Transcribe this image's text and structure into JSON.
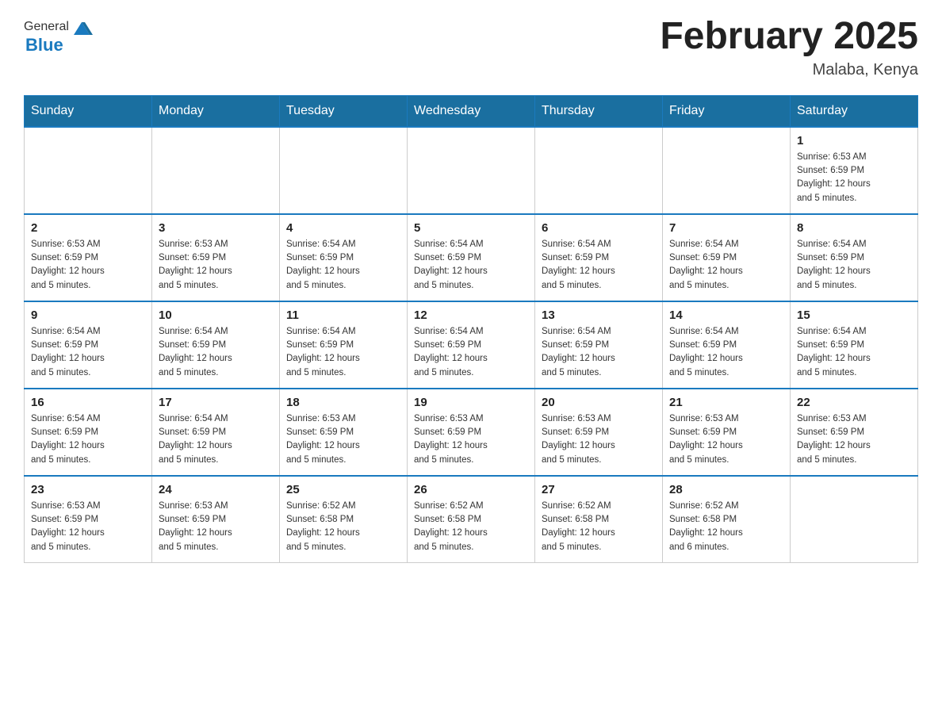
{
  "logo": {
    "general": "General",
    "blue": "Blue"
  },
  "title": "February 2025",
  "location": "Malaba, Kenya",
  "days_of_week": [
    "Sunday",
    "Monday",
    "Tuesday",
    "Wednesday",
    "Thursday",
    "Friday",
    "Saturday"
  ],
  "weeks": [
    [
      {
        "day": "",
        "info": ""
      },
      {
        "day": "",
        "info": ""
      },
      {
        "day": "",
        "info": ""
      },
      {
        "day": "",
        "info": ""
      },
      {
        "day": "",
        "info": ""
      },
      {
        "day": "",
        "info": ""
      },
      {
        "day": "1",
        "sunrise": "6:53 AM",
        "sunset": "6:59 PM",
        "daylight": "12 hours and 5 minutes."
      }
    ],
    [
      {
        "day": "2",
        "sunrise": "6:53 AM",
        "sunset": "6:59 PM",
        "daylight": "12 hours and 5 minutes."
      },
      {
        "day": "3",
        "sunrise": "6:53 AM",
        "sunset": "6:59 PM",
        "daylight": "12 hours and 5 minutes."
      },
      {
        "day": "4",
        "sunrise": "6:54 AM",
        "sunset": "6:59 PM",
        "daylight": "12 hours and 5 minutes."
      },
      {
        "day": "5",
        "sunrise": "6:54 AM",
        "sunset": "6:59 PM",
        "daylight": "12 hours and 5 minutes."
      },
      {
        "day": "6",
        "sunrise": "6:54 AM",
        "sunset": "6:59 PM",
        "daylight": "12 hours and 5 minutes."
      },
      {
        "day": "7",
        "sunrise": "6:54 AM",
        "sunset": "6:59 PM",
        "daylight": "12 hours and 5 minutes."
      },
      {
        "day": "8",
        "sunrise": "6:54 AM",
        "sunset": "6:59 PM",
        "daylight": "12 hours and 5 minutes."
      }
    ],
    [
      {
        "day": "9",
        "sunrise": "6:54 AM",
        "sunset": "6:59 PM",
        "daylight": "12 hours and 5 minutes."
      },
      {
        "day": "10",
        "sunrise": "6:54 AM",
        "sunset": "6:59 PM",
        "daylight": "12 hours and 5 minutes."
      },
      {
        "day": "11",
        "sunrise": "6:54 AM",
        "sunset": "6:59 PM",
        "daylight": "12 hours and 5 minutes."
      },
      {
        "day": "12",
        "sunrise": "6:54 AM",
        "sunset": "6:59 PM",
        "daylight": "12 hours and 5 minutes."
      },
      {
        "day": "13",
        "sunrise": "6:54 AM",
        "sunset": "6:59 PM",
        "daylight": "12 hours and 5 minutes."
      },
      {
        "day": "14",
        "sunrise": "6:54 AM",
        "sunset": "6:59 PM",
        "daylight": "12 hours and 5 minutes."
      },
      {
        "day": "15",
        "sunrise": "6:54 AM",
        "sunset": "6:59 PM",
        "daylight": "12 hours and 5 minutes."
      }
    ],
    [
      {
        "day": "16",
        "sunrise": "6:54 AM",
        "sunset": "6:59 PM",
        "daylight": "12 hours and 5 minutes."
      },
      {
        "day": "17",
        "sunrise": "6:54 AM",
        "sunset": "6:59 PM",
        "daylight": "12 hours and 5 minutes."
      },
      {
        "day": "18",
        "sunrise": "6:53 AM",
        "sunset": "6:59 PM",
        "daylight": "12 hours and 5 minutes."
      },
      {
        "day": "19",
        "sunrise": "6:53 AM",
        "sunset": "6:59 PM",
        "daylight": "12 hours and 5 minutes."
      },
      {
        "day": "20",
        "sunrise": "6:53 AM",
        "sunset": "6:59 PM",
        "daylight": "12 hours and 5 minutes."
      },
      {
        "day": "21",
        "sunrise": "6:53 AM",
        "sunset": "6:59 PM",
        "daylight": "12 hours and 5 minutes."
      },
      {
        "day": "22",
        "sunrise": "6:53 AM",
        "sunset": "6:59 PM",
        "daylight": "12 hours and 5 minutes."
      }
    ],
    [
      {
        "day": "23",
        "sunrise": "6:53 AM",
        "sunset": "6:59 PM",
        "daylight": "12 hours and 5 minutes."
      },
      {
        "day": "24",
        "sunrise": "6:53 AM",
        "sunset": "6:59 PM",
        "daylight": "12 hours and 5 minutes."
      },
      {
        "day": "25",
        "sunrise": "6:52 AM",
        "sunset": "6:58 PM",
        "daylight": "12 hours and 5 minutes."
      },
      {
        "day": "26",
        "sunrise": "6:52 AM",
        "sunset": "6:58 PM",
        "daylight": "12 hours and 5 minutes."
      },
      {
        "day": "27",
        "sunrise": "6:52 AM",
        "sunset": "6:58 PM",
        "daylight": "12 hours and 5 minutes."
      },
      {
        "day": "28",
        "sunrise": "6:52 AM",
        "sunset": "6:58 PM",
        "daylight": "12 hours and 6 minutes."
      },
      {
        "day": "",
        "info": ""
      }
    ]
  ],
  "labels": {
    "sunrise": "Sunrise:",
    "sunset": "Sunset:",
    "daylight": "Daylight:"
  }
}
